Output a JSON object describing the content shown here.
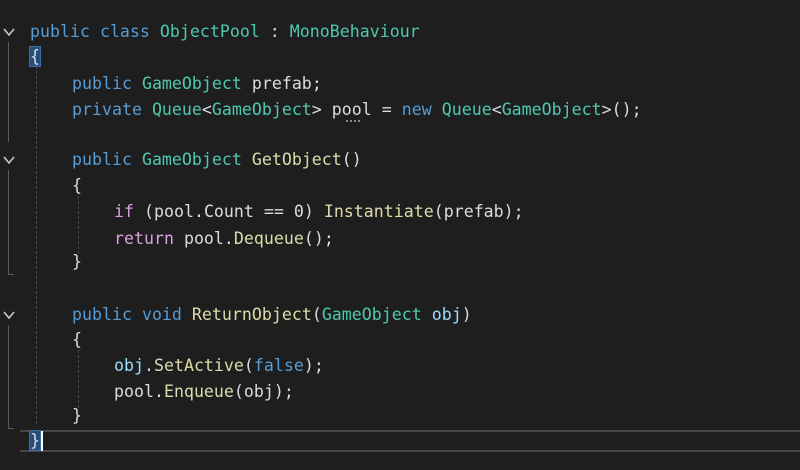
{
  "code": {
    "line1": {
      "kw1": "public",
      "kw2": "class",
      "name": "ObjectPool",
      "sep": " : ",
      "base": "MonoBehaviour"
    },
    "line2": {
      "brace": "{"
    },
    "line3": {
      "kw1": "public",
      "type": "GameObject",
      "name": "prefab",
      "end": ";"
    },
    "line4": {
      "kw1": "private",
      "type1": "Queue",
      "lt1": "<",
      "type2": "GameObject",
      "gt1": ">",
      "name": "pool",
      "eq": " = ",
      "kw2": "new",
      "type3": "Queue",
      "lt2": "<",
      "type4": "GameObject",
      "gt2": ">",
      "end": "();"
    },
    "line5": {
      "kw1": "public",
      "type": "GameObject",
      "name": "GetObject",
      "end": "()"
    },
    "line6": {
      "brace": "{"
    },
    "line7": {
      "kw": "if",
      "open": " (",
      "obj": "pool",
      "dot": ".",
      "prop": "Count",
      "cmp": " == 0) ",
      "fn": "Instantiate",
      "args": "(prefab);"
    },
    "line8": {
      "kw": "return",
      "obj": "pool",
      "dot": ".",
      "fn": "Dequeue",
      "end": "();"
    },
    "line9": {
      "brace": "}"
    },
    "line10": {
      "kw1": "public",
      "kw2": "void",
      "name": "ReturnObject",
      "open": "(",
      "type": "GameObject",
      "param": "obj",
      "close": ")"
    },
    "line11": {
      "brace": "{"
    },
    "line12": {
      "obj": "obj",
      "dot": ".",
      "fn": "SetActive",
      "open": "(",
      "val": "false",
      "end": ");"
    },
    "line13": {
      "obj": "pool",
      "dot": ".",
      "fn": "Enqueue",
      "end": "(obj);"
    },
    "line14": {
      "brace": "}"
    },
    "line15": {
      "brace": "}"
    }
  },
  "icons": {
    "fold": "chevron-down-icon"
  },
  "colors": {
    "background": "#1e1e1e",
    "keyword": "#569cd6",
    "type": "#4ec9b0",
    "function": "#dcdcaa",
    "plain": "#dcdcdc",
    "control": "#d8a0df"
  }
}
